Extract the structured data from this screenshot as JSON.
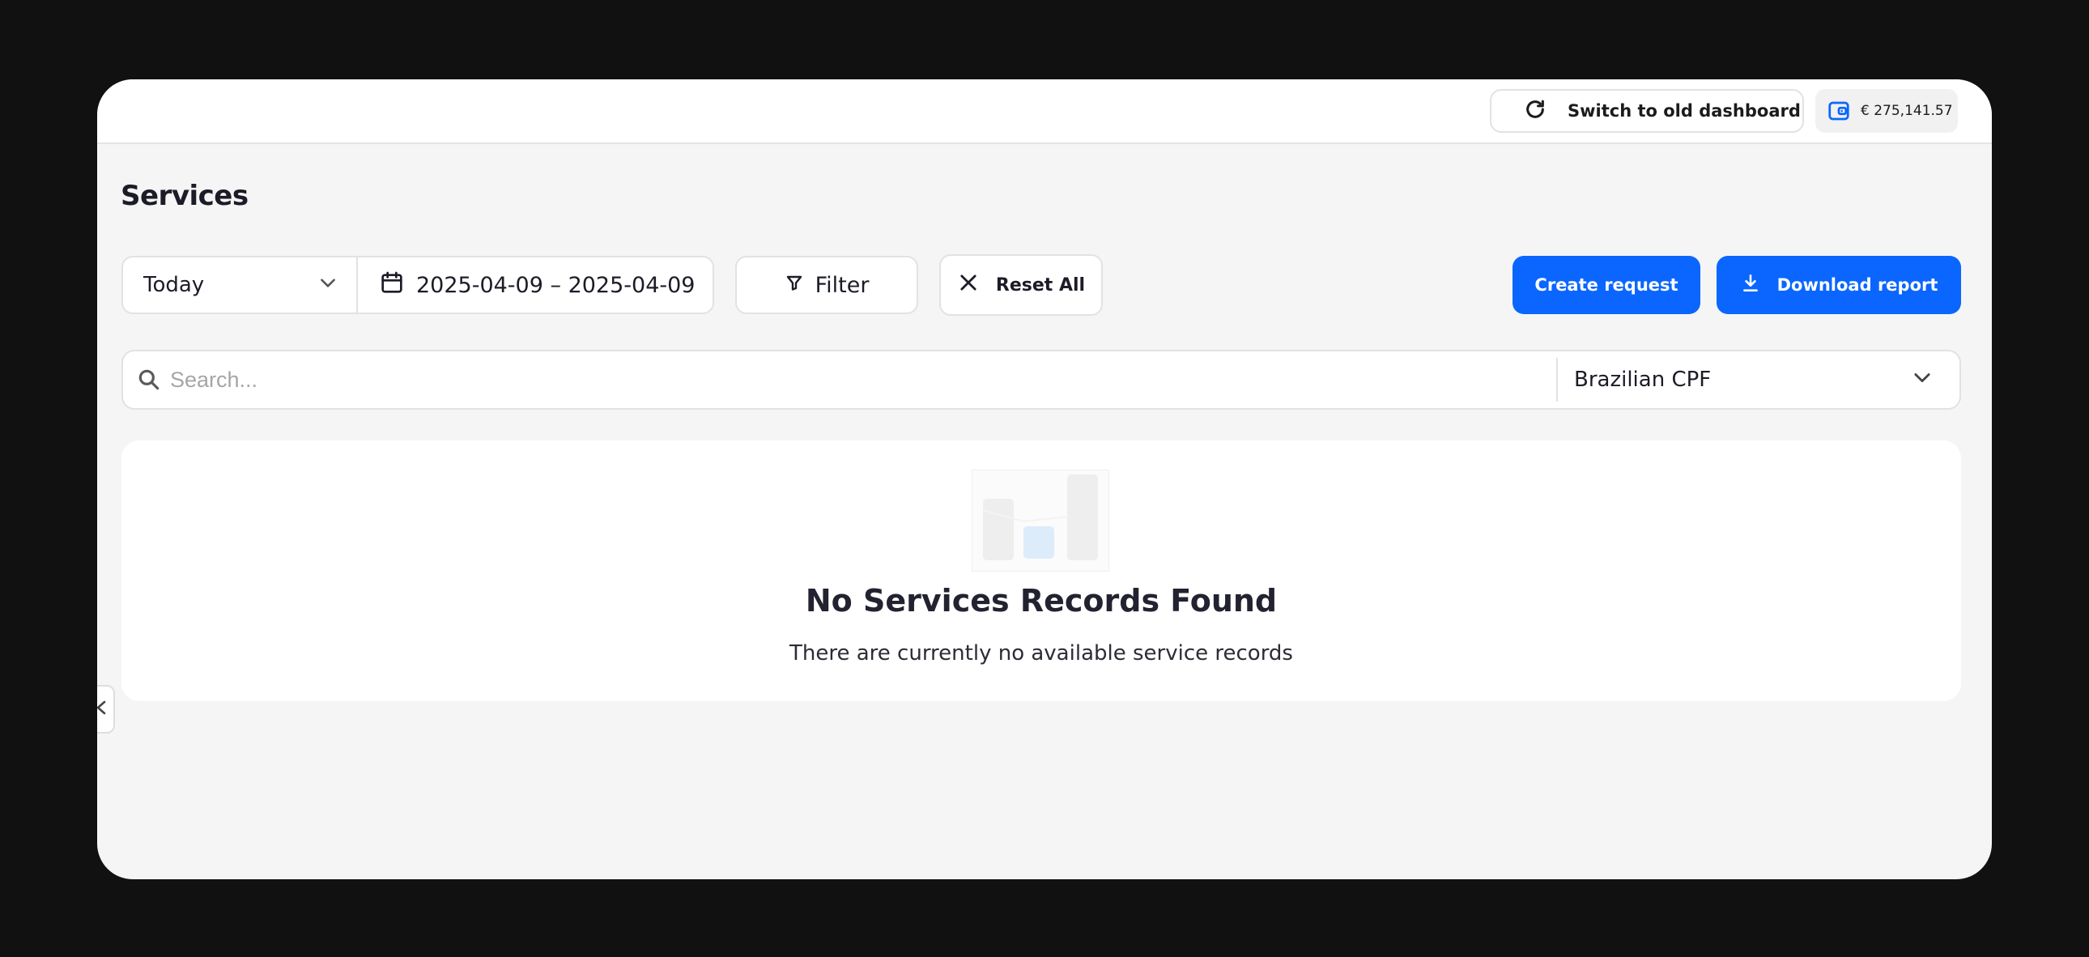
{
  "header": {
    "switch_label": "Switch to old dashboard",
    "balance": "€ 275,141.57"
  },
  "page": {
    "title": "Services"
  },
  "toolbar": {
    "period_label": "Today",
    "date_range": "2025-04-09 – 2025-04-09",
    "filter_label": "Filter",
    "reset_label": "Reset All",
    "create_label": "Create request",
    "download_label": "Download report"
  },
  "search": {
    "placeholder": "Search...",
    "document_type": "Brazilian CPF"
  },
  "empty_state": {
    "title": "No Services Records Found",
    "subtitle": "There are currently no available service records"
  },
  "colors": {
    "primary": "#0a66ff",
    "background": "#f5f5f5",
    "frame": "#111111"
  }
}
